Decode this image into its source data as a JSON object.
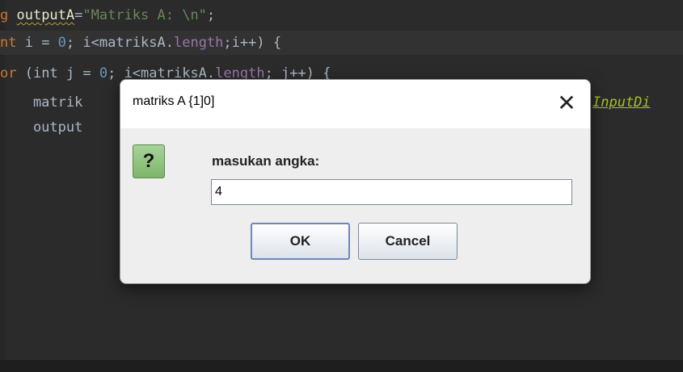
{
  "editor": {
    "lines": [
      {
        "a": "g ",
        "b": "outputA",
        "c": "=",
        "d": "\"Matriks A: \\n\"",
        "e": ";"
      },
      {
        "a": "nt ",
        "b": "i = ",
        "c": "0",
        "d": "; i<matriksA.",
        "e": "length",
        "f": ";i++) {"
      },
      {
        "a": "or ",
        "b": "(int j = ",
        "c": "0",
        "d": "; i<matriksA.",
        "e": "length",
        "f": "; j++) {"
      },
      {
        "a": "    matrik",
        "b": "InputDi"
      },
      {
        "a": "    output"
      }
    ]
  },
  "dialog": {
    "title": "matriks A {1]0]",
    "close_symbol": "✕",
    "icon_symbol": "?",
    "prompt": "masukan angka:",
    "input_value": "4",
    "ok_label": "OK",
    "cancel_label": "Cancel"
  }
}
